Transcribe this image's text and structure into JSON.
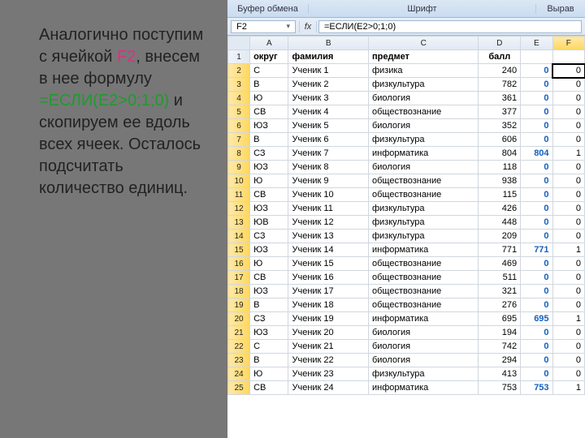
{
  "slide_text": {
    "p1a": "Аналогично поступим с ячейкой ",
    "p1b": "F2",
    "p1c": ", внесем в нее формулу ",
    "p1d": "=ЕСЛИ(E2>0;1;0)",
    "p1e": " и скопируем ее вдоль всех ячеек. Осталось подсчитать количество единиц."
  },
  "ribbon": {
    "sec1": "Буфер обмена",
    "sec2": "Шрифт",
    "sec3": "Вырав"
  },
  "name_box": {
    "value": "F2"
  },
  "fx_label": "fx",
  "formula": "=ЕСЛИ(E2>0;1;0)",
  "columns": [
    "A",
    "B",
    "C",
    "D",
    "E",
    "F"
  ],
  "headers": {
    "A": "округ",
    "B": "фамилия",
    "C": "предмет",
    "D": "балл"
  },
  "active_cell": "F2",
  "rows": [
    {
      "n": 2,
      "A": "С",
      "B": "Ученик 1",
      "C": "физика",
      "D": 240,
      "E": 0,
      "F": 0
    },
    {
      "n": 3,
      "A": "В",
      "B": "Ученик 2",
      "C": "физкультура",
      "D": 782,
      "E": 0,
      "F": 0
    },
    {
      "n": 4,
      "A": "Ю",
      "B": "Ученик 3",
      "C": "биология",
      "D": 361,
      "E": 0,
      "F": 0
    },
    {
      "n": 5,
      "A": "СВ",
      "B": "Ученик 4",
      "C": "обществознание",
      "D": 377,
      "E": 0,
      "F": 0
    },
    {
      "n": 6,
      "A": "ЮЗ",
      "B": "Ученик 5",
      "C": "биология",
      "D": 352,
      "E": 0,
      "F": 0
    },
    {
      "n": 7,
      "A": "В",
      "B": "Ученик 6",
      "C": "физкультура",
      "D": 606,
      "E": 0,
      "F": 0
    },
    {
      "n": 8,
      "A": "СЗ",
      "B": "Ученик 7",
      "C": "информатика",
      "D": 804,
      "E": 804,
      "F": 1
    },
    {
      "n": 9,
      "A": "ЮЗ",
      "B": "Ученик 8",
      "C": "биология",
      "D": 118,
      "E": 0,
      "F": 0
    },
    {
      "n": 10,
      "A": "Ю",
      "B": "Ученик 9",
      "C": "обществознание",
      "D": 938,
      "E": 0,
      "F": 0
    },
    {
      "n": 11,
      "A": "СВ",
      "B": "Ученик 10",
      "C": "обществознание",
      "D": 115,
      "E": 0,
      "F": 0
    },
    {
      "n": 12,
      "A": "ЮЗ",
      "B": "Ученик 11",
      "C": "физкультура",
      "D": 426,
      "E": 0,
      "F": 0
    },
    {
      "n": 13,
      "A": "ЮВ",
      "B": "Ученик 12",
      "C": "физкультура",
      "D": 448,
      "E": 0,
      "F": 0
    },
    {
      "n": 14,
      "A": "СЗ",
      "B": "Ученик 13",
      "C": "физкультура",
      "D": 209,
      "E": 0,
      "F": 0
    },
    {
      "n": 15,
      "A": "ЮЗ",
      "B": "Ученик 14",
      "C": "информатика",
      "D": 771,
      "E": 771,
      "F": 1
    },
    {
      "n": 16,
      "A": "Ю",
      "B": "Ученик 15",
      "C": "обществознание",
      "D": 469,
      "E": 0,
      "F": 0
    },
    {
      "n": 17,
      "A": "СВ",
      "B": "Ученик 16",
      "C": "обществознание",
      "D": 511,
      "E": 0,
      "F": 0
    },
    {
      "n": 18,
      "A": "ЮЗ",
      "B": "Ученик 17",
      "C": "обществознание",
      "D": 321,
      "E": 0,
      "F": 0
    },
    {
      "n": 19,
      "A": "В",
      "B": "Ученик 18",
      "C": "обществознание",
      "D": 276,
      "E": 0,
      "F": 0
    },
    {
      "n": 20,
      "A": "СЗ",
      "B": "Ученик 19",
      "C": "информатика",
      "D": 695,
      "E": 695,
      "F": 1
    },
    {
      "n": 21,
      "A": "ЮЗ",
      "B": "Ученик 20",
      "C": "биология",
      "D": 194,
      "E": 0,
      "F": 0
    },
    {
      "n": 22,
      "A": "С",
      "B": "Ученик 21",
      "C": "биология",
      "D": 742,
      "E": 0,
      "F": 0
    },
    {
      "n": 23,
      "A": "В",
      "B": "Ученик 22",
      "C": "биология",
      "D": 294,
      "E": 0,
      "F": 0
    },
    {
      "n": 24,
      "A": "Ю",
      "B": "Ученик 23",
      "C": "физкультура",
      "D": 413,
      "E": 0,
      "F": 0
    },
    {
      "n": 25,
      "A": "СВ",
      "B": "Ученик 24",
      "C": "информатика",
      "D": 753,
      "E": 753,
      "F": 1
    }
  ]
}
